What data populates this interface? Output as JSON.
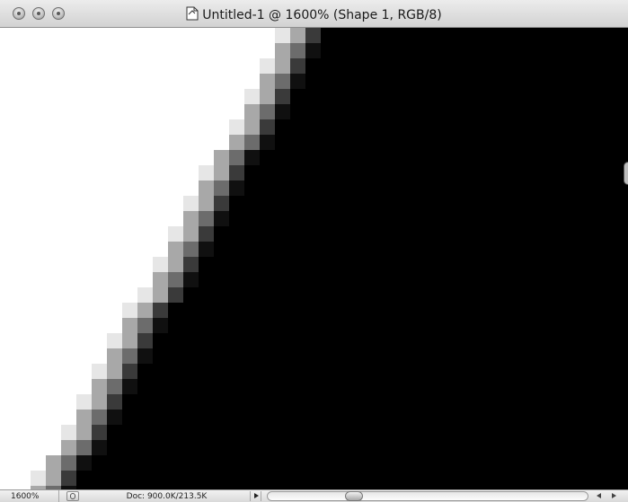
{
  "window": {
    "title": "Untitled-1 @ 1600% (Shape 1, RGB/8)",
    "title_icon": "document-icon",
    "buttons": [
      "close-button",
      "minimize-button",
      "zoom-button"
    ]
  },
  "canvas": {
    "description_colors": {
      "fill": "#000000",
      "background": "#ffffff"
    }
  },
  "status_bar": {
    "zoom": "1600%",
    "doc_info": "Doc: 900.0K/213.5K",
    "scroll_position": 0.3
  }
}
